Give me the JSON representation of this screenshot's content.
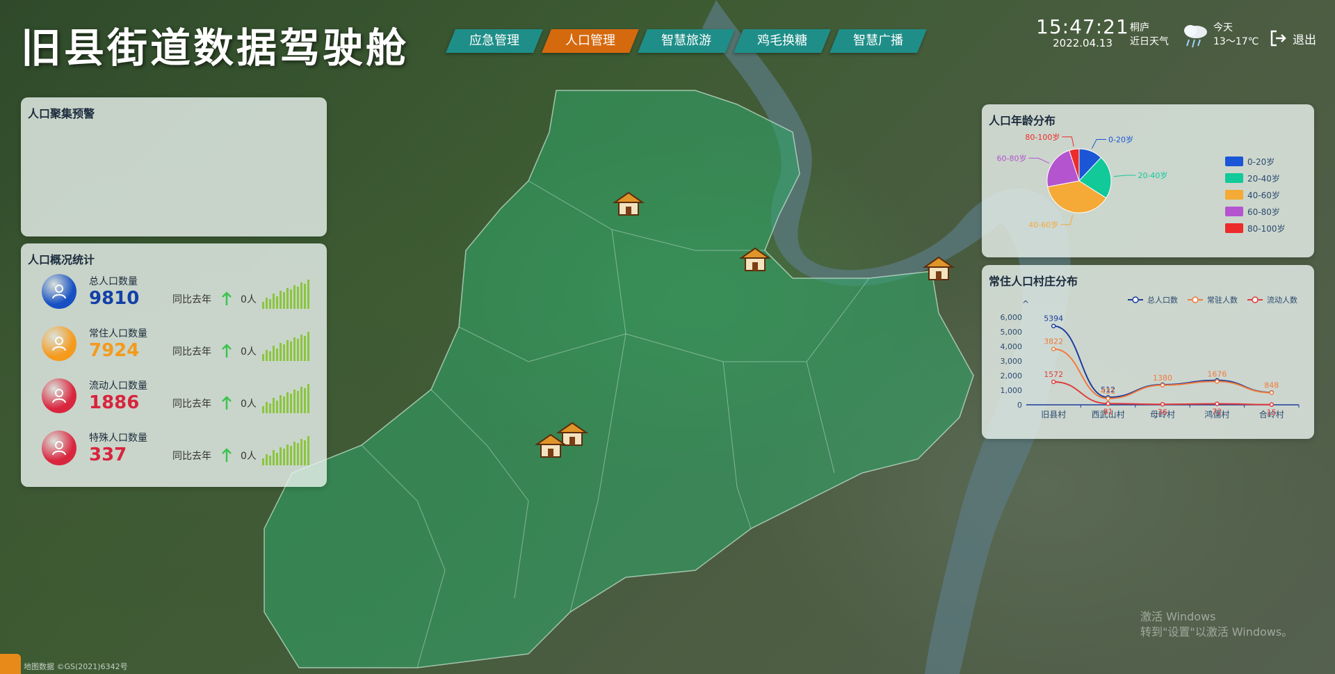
{
  "app": {
    "title": "旧县街道数据驾驶舱"
  },
  "nav": [
    {
      "label": "应急管理",
      "active": false
    },
    {
      "label": "人口管理",
      "active": true
    },
    {
      "label": "智慧旅游",
      "active": false
    },
    {
      "label": "鸡毛换糖",
      "active": false
    },
    {
      "label": "智慧广播",
      "active": false
    }
  ],
  "clock": {
    "time": "15:47:21",
    "date": "2022.04.13"
  },
  "location": {
    "city": "桐庐",
    "label": "近日天气"
  },
  "weather": {
    "icon": "cloud-rain-icon",
    "day": "今天",
    "temp": "13～17℃"
  },
  "logout": {
    "label": "退出",
    "icon": "logout-icon"
  },
  "warning_panel": {
    "title": "人口聚集预警"
  },
  "stats_panel": {
    "title": "人口概况统计",
    "yoy_label": "同比去年",
    "items": [
      {
        "label": "总人口数量",
        "value": "9810",
        "delta": "0人",
        "icon": "users-icon",
        "color": "#1340a8",
        "icon_color": "#1650c2"
      },
      {
        "label": "常住人口数量",
        "value": "7924",
        "delta": "0人",
        "icon": "home-user-icon",
        "color": "#f39a1e",
        "icon_color": "#f59a1c"
      },
      {
        "label": "流动人口数量",
        "value": "1886",
        "delta": "0人",
        "icon": "moving-user-icon",
        "color": "#d8243e",
        "icon_color": "#d9263f"
      },
      {
        "label": "特殊人口数量",
        "value": "337",
        "delta": "0人",
        "icon": "special-user-icon",
        "color": "#d8243e",
        "icon_color": "#d9263f"
      }
    ]
  },
  "age_panel": {
    "title": "人口年龄分布",
    "legend": [
      {
        "label": "0-20岁",
        "color": "#1a56d6"
      },
      {
        "label": "20-40岁",
        "color": "#12c99a"
      },
      {
        "label": "40-60岁",
        "color": "#f5a937"
      },
      {
        "label": "60-80岁",
        "color": "#b455cf"
      },
      {
        "label": "80-100岁",
        "color": "#ec2b2b"
      }
    ]
  },
  "village_panel": {
    "title": "常住人口村庄分布",
    "legend": [
      "总人口数",
      "常驻人数",
      "流动人数"
    ],
    "axis_arrow": "^"
  },
  "watermark": {
    "line1": "激活 Windows",
    "line2": "转到\"设置\"以激活 Windows。"
  },
  "map_credit": "地图数据 ©GS(2021)6342号",
  "chart_data": [
    {
      "type": "pie",
      "categories": [
        "0-20岁",
        "20-40岁",
        "40-60岁",
        "60-80岁",
        "80-100岁"
      ],
      "values": [
        12,
        22,
        38,
        23,
        5
      ],
      "colors": [
        "#1a56d6",
        "#12c99a",
        "#f5a937",
        "#b455cf",
        "#ec2b2b"
      ],
      "legend_position": "right"
    },
    {
      "type": "line",
      "categories": [
        "旧县村",
        "西武山村",
        "母岭村",
        "鸿儒村",
        "合岭村"
      ],
      "series": [
        {
          "name": "总人口数",
          "values": [
            5394,
            512,
            1380,
            1676,
            848
          ],
          "color": "#1c3d9c",
          "labels": [
            "5394",
            "512",
            "",
            "",
            ""
          ]
        },
        {
          "name": "常驻人数",
          "values": [
            3822,
            431,
            1344,
            1604,
            833
          ],
          "color": "#f07a3c",
          "labels": [
            "3822",
            "431",
            "1380",
            "1676",
            "848"
          ]
        },
        {
          "name": "流动人数",
          "values": [
            1572,
            81,
            36,
            72,
            15
          ],
          "color": "#e03b3b",
          "labels": [
            "1572",
            "81",
            "36",
            "72",
            "15"
          ]
        }
      ],
      "yticks": [
        "0",
        "1,000",
        "2,000",
        "3,000",
        "4,000",
        "5,000",
        "6,000"
      ],
      "ylim": [
        0,
        6000
      ],
      "legend_position": "top-right"
    }
  ]
}
